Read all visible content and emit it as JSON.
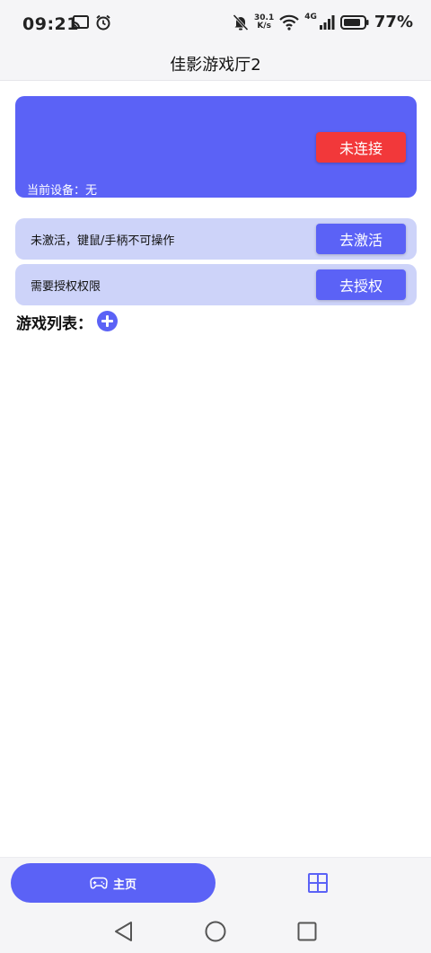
{
  "status_bar": {
    "time": "09:21",
    "net_speed_value": "30.1",
    "net_speed_unit": "K/s",
    "network_type": "4G",
    "battery": "77%",
    "icons": [
      "cast-icon",
      "alarm-icon",
      "mute-bell-icon",
      "wifi-icon",
      "signal-icon",
      "battery-icon"
    ]
  },
  "header": {
    "title": "佳影游戏厅2"
  },
  "device_card": {
    "connect_button": "未连接",
    "current_device": "当前设备：无",
    "bg_color": "#5b62f6",
    "button_color": "#f2383a"
  },
  "notices": [
    {
      "text": "未激活，键鼠/手柄不可操作",
      "button": "去激活"
    },
    {
      "text": "需要授权权限",
      "button": "去授权"
    }
  ],
  "games": {
    "heading": "游戏列表：",
    "add_icon": "plus-circle-icon"
  },
  "tabs": {
    "home_label": "主页",
    "home_icon": "gamepad-icon",
    "second_icon": "grid-icon",
    "accent": "#5b62f6"
  },
  "system_nav": {
    "icons": [
      "back-icon",
      "home-icon",
      "recents-icon"
    ]
  }
}
